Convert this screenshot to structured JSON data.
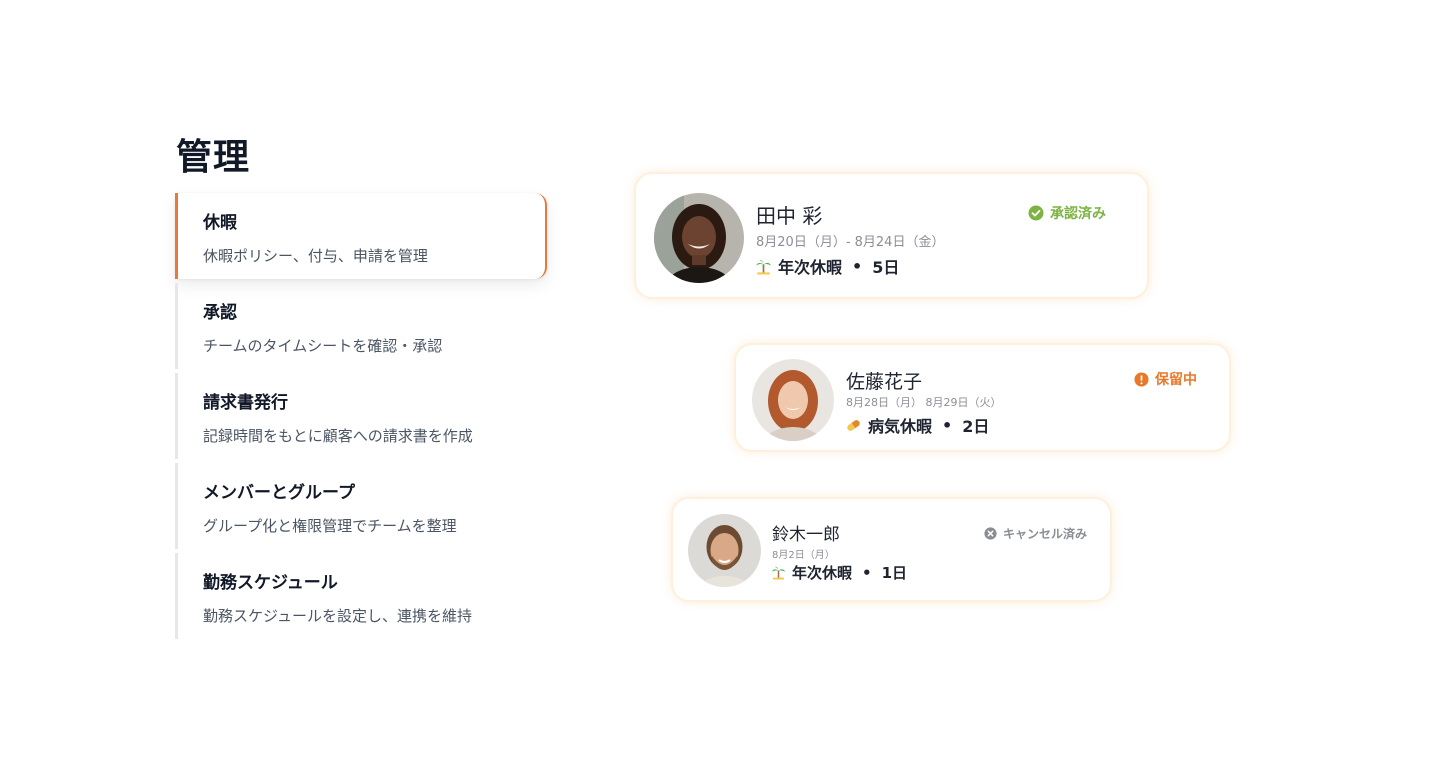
{
  "section": {
    "title": "管理"
  },
  "menu": {
    "items": [
      {
        "title": "休暇",
        "description": "休暇ポリシー、付与、申請を管理",
        "active": true
      },
      {
        "title": "承認",
        "description": "チームのタイムシートを確認・承認",
        "active": false
      },
      {
        "title": "請求書発行",
        "description": "記録時間をもとに顧客への請求書を作成",
        "active": false
      },
      {
        "title": "メンバーとグループ",
        "description": "グループ化と権限管理でチームを整理",
        "active": false
      },
      {
        "title": "勤務スケジュール",
        "description": "勤務スケジュールを設定し、連携を維持",
        "active": false
      }
    ],
    "accent_color": "#e8793b"
  },
  "requests": [
    {
      "name": "田中 彩",
      "dates": "8月20日（月）- 8月24日（金）",
      "type_icon": "palm-tree-icon",
      "type": "年次休暇",
      "separator": "•",
      "duration": "5日",
      "status": "承認済み",
      "status_icon": "check-circle-icon",
      "status_color": "#7cb342"
    },
    {
      "name": "佐藤花子",
      "dates": "8月28日（月） 8月29日（火）",
      "type_icon": "pill-icon",
      "type": "病気休暇",
      "separator": "•",
      "duration": "2日",
      "status": "保留中",
      "status_icon": "alert-circle-icon",
      "status_color": "#e8792b"
    },
    {
      "name": "鈴木一郎",
      "dates": "8月2日（月）",
      "type_icon": "palm-tree-icon",
      "type": "年次休暇",
      "separator": "•",
      "duration": "1日",
      "status": "キャンセル済み",
      "status_icon": "x-circle-icon",
      "status_color": "#8a8d93"
    }
  ]
}
